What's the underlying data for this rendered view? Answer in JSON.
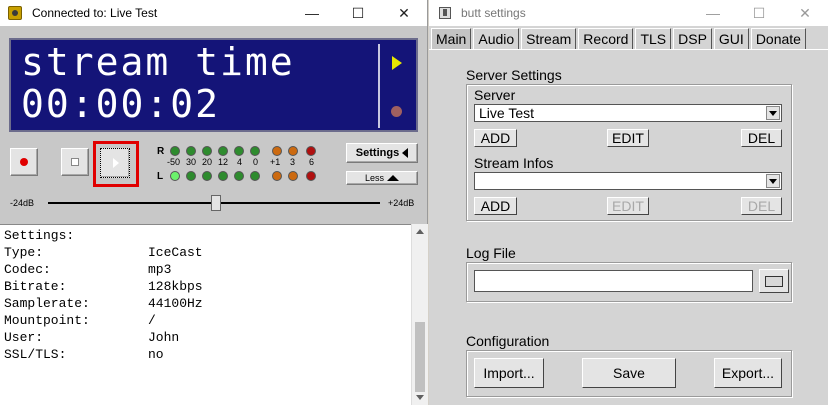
{
  "player": {
    "title": "Connected to: Live Test",
    "lcd_line1": "stream time",
    "lcd_line2": "00:00:02",
    "settings_label": "Settings",
    "less_label": "Less",
    "vu": {
      "r_label": "R",
      "l_label": "L",
      "scale": [
        "-50",
        "30",
        "20",
        "12",
        "4",
        "0",
        "+1",
        "3",
        "6"
      ]
    },
    "gain_min": "-24dB",
    "gain_max": "+24dB",
    "gain_value_db": 0,
    "info_header": "Settings:",
    "info_rows": [
      {
        "key": "Type:",
        "value": "IceCast"
      },
      {
        "key": "Codec:",
        "value": "mp3"
      },
      {
        "key": "Bitrate:",
        "value": "128kbps"
      },
      {
        "key": "Samplerate:",
        "value": "44100Hz"
      },
      {
        "key": "Mountpoint:",
        "value": "/"
      },
      {
        "key": "User:",
        "value": "John"
      },
      {
        "key": "SSL/TLS:",
        "value": "no"
      }
    ]
  },
  "settings_window": {
    "title": "butt settings",
    "tabs": [
      "Main",
      "Audio",
      "Stream",
      "Record",
      "TLS",
      "DSP",
      "GUI",
      "Donate"
    ],
    "active_tab": "Main",
    "server_settings_label": "Server Settings",
    "server_label": "Server",
    "server_value": "Live Test",
    "add_label": "ADD",
    "edit_label": "EDIT",
    "del_label": "DEL",
    "stream_infos_label": "Stream Infos",
    "stream_infos_value": "",
    "log_file_label": "Log File",
    "log_file_value": "",
    "configuration_label": "Configuration",
    "import_label": "Import...",
    "save_label": "Save",
    "export_label": "Export..."
  },
  "colors": {
    "lcd_bg": "#141478",
    "record_highlight": "#e00000",
    "led_green_on": "#6cf26c"
  }
}
